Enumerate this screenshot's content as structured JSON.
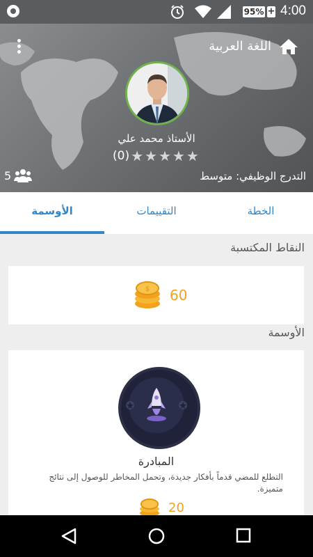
{
  "status_bar": {
    "battery": "95%",
    "battery_plus": "+",
    "time": "4:00"
  },
  "header": {
    "app_title": "اللغة العربية",
    "teacher_name": "الأستاذ محمد علي",
    "rating_count": "(0)",
    "followers_count": "5",
    "career_level": "التدرج الوظيفي: متوسط"
  },
  "tabs": [
    {
      "label": "الخطة"
    },
    {
      "label": "التقييمات"
    },
    {
      "label": "الأوسمة"
    }
  ],
  "points_section": {
    "title": "النقاط المكتسبة",
    "value": "60"
  },
  "badges_section": {
    "title": "الأوسمة",
    "badge": {
      "name": "المبادرة",
      "description": "التطلع للمضي قدماً بأفكار جديدة، وتحمل المخاطر للوصول إلى نتائج متميزة.",
      "points": "20"
    }
  },
  "colors": {
    "accent": "#2f86c8",
    "coin": "#f2a21c",
    "avatar_border": "#6fb34a"
  },
  "icons": [
    "notification-icon",
    "alarm-icon",
    "wifi-icon",
    "signal-icon",
    "menu-icon",
    "home-icon",
    "star-icon",
    "people-icon",
    "coin-icon",
    "rocket-icon",
    "back-icon",
    "circle-home-icon",
    "recent-apps-icon"
  ]
}
